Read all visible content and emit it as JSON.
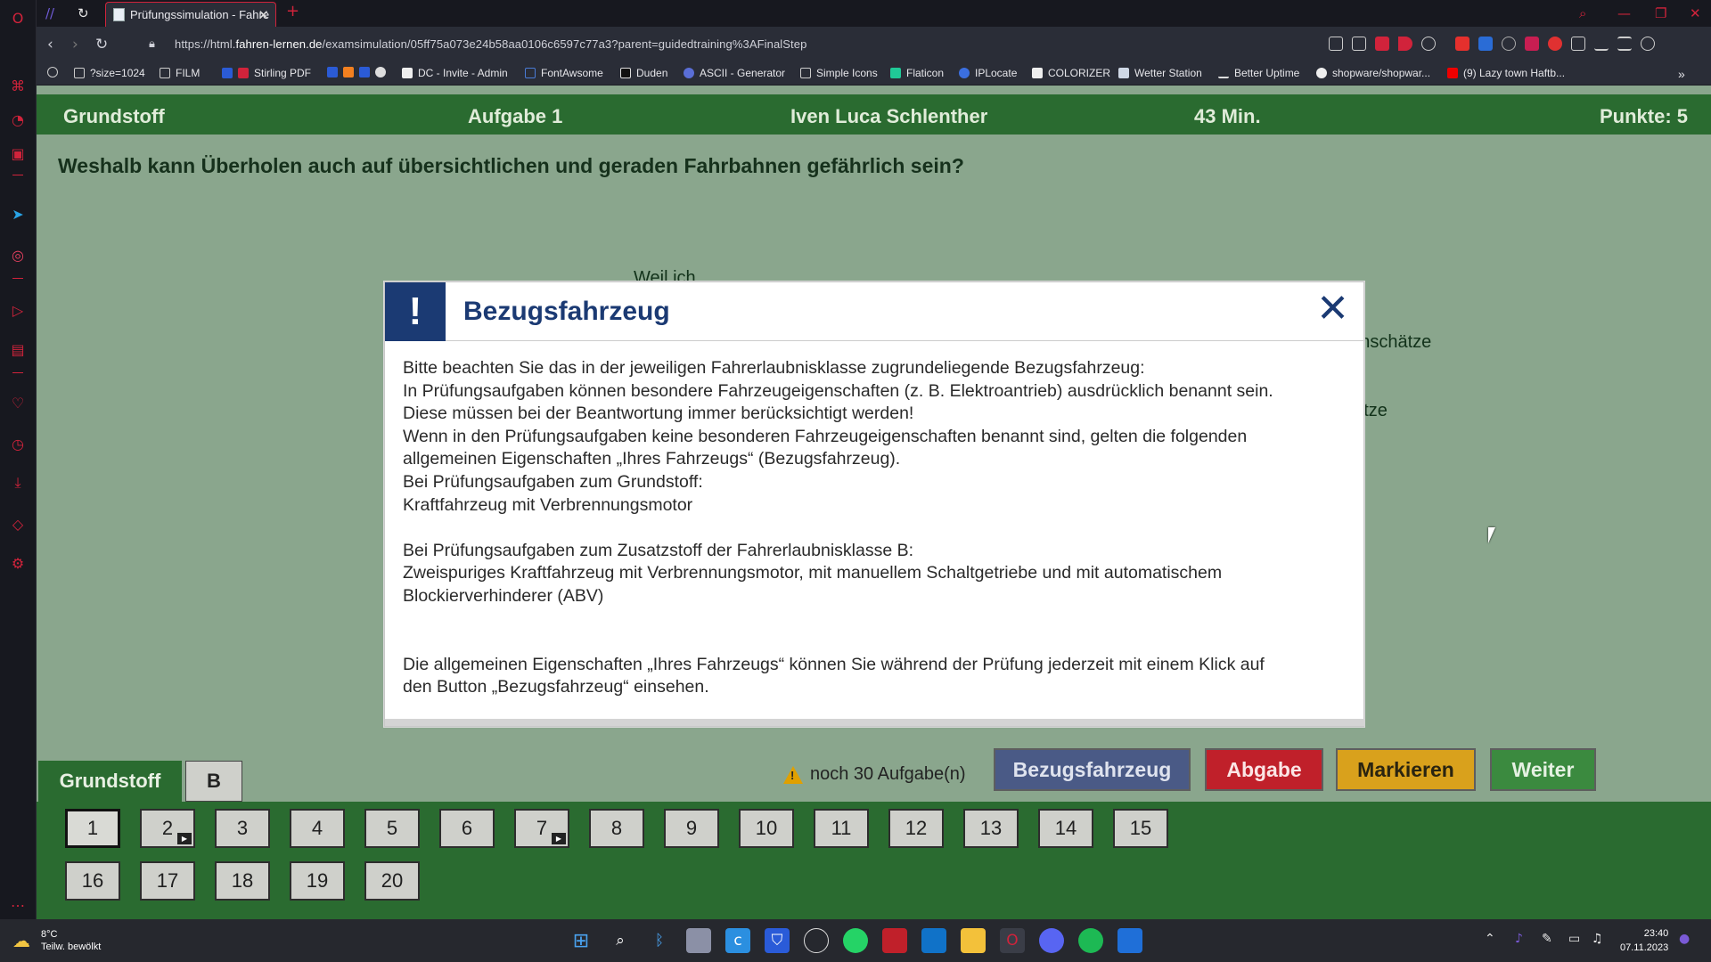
{
  "browser": {
    "tab": {
      "title": "Prüfungssimulation - Fahre"
    },
    "new_tab_symbol": "+",
    "url_prefix": "https://html.",
    "url_domain": "fahren-lernen.de",
    "url_path": "/examsimulation/05ff75a073e24b58aa0106c6597c77a3?parent=guidedtraining%3AFinalStep",
    "bookmarks": [
      "?size=1024",
      "FILM",
      "Stirling PDF",
      "DC - Invite - Admin",
      "FontAwsome",
      "Duden",
      "ASCII - Generator",
      "Simple Icons",
      "Flaticon",
      "IPLocate",
      "COLORIZER",
      "Wetter Station",
      "Better Uptime",
      "shopware/shopwar...",
      "(9) Lazy town Haftb..."
    ]
  },
  "topbar": {
    "category": "Grundstoff",
    "task": "Aufgabe 1",
    "name": "Iven Luca Schlenther",
    "time": "43 Min.",
    "points": "Punkte: 5"
  },
  "question": "Weshalb kann Überholen auch auf übersichtlichen und geraden Fahrbahnen gefährlich sein?",
  "background_answers": [
    "Weil ich",
    "g einschätze",
    "hätze"
  ],
  "modal": {
    "title": "Bezugsfahrzeug",
    "lines": [
      "Bitte beachten Sie das in der jeweiligen Fahrerlaubnisklasse zugrundeliegende Bezugsfahrzeug:",
      "In Prüfungsaufgaben können besondere Fahrzeugeigenschaften (z. B. Elektroantrieb) ausdrücklich benannt sein.",
      "Diese müssen bei der Beantwortung immer berücksichtigt werden!",
      "Wenn in den Prüfungsaufgaben keine besonderen Fahrzeugeigenschaften benannt sind, gelten die folgenden",
      "allgemeinen Eigenschaften „Ihres Fahrzeugs“ (Bezugsfahrzeug).",
      "Bei Prüfungsaufgaben zum Grundstoff:",
      "Kraftfahrzeug mit Verbrennungsmotor",
      "",
      "Bei Prüfungsaufgaben zum Zusatzstoff der Fahrerlaubnisklasse B:",
      "Zweispuriges Kraftfahrzeug mit Verbrennungsmotor, mit manuellem Schaltgetriebe und mit automatischem",
      "Blockierverhinderer (ABV)",
      "",
      "",
      "Die allgemeinen Eigenschaften „Ihres Fahrzeugs“ können Sie während der Prüfung jederzeit mit einem Klick auf",
      "den Button „Bezugsfahrzeug“ einsehen."
    ]
  },
  "category_tabs": [
    "Grundstoff",
    "B"
  ],
  "remaining": "noch 30 Aufgabe(n)",
  "buttons": {
    "reference": "Bezugsfahrzeug",
    "submit": "Abgabe",
    "mark": "Markieren",
    "next": "Weiter"
  },
  "task_numbers": [
    "1",
    "2",
    "3",
    "4",
    "5",
    "6",
    "7",
    "8",
    "9",
    "10",
    "11",
    "12",
    "13",
    "14",
    "15",
    "16",
    "17",
    "18",
    "19",
    "20"
  ],
  "video_tasks": [
    "2",
    "7"
  ],
  "colors": {
    "header_green": "#2a6b30",
    "page_bg": "#8aa68d",
    "modal_blue": "#1b3a73",
    "reference_btn": "#4a5a86",
    "submit_btn": "#c0202a",
    "mark_btn": "#d9a11c",
    "next_btn": "#3b8a3f"
  },
  "taskbar": {
    "temperature": "8°C",
    "weather": "Teilw. bewölkt",
    "time": "23:40",
    "date": "07.11.2023"
  }
}
